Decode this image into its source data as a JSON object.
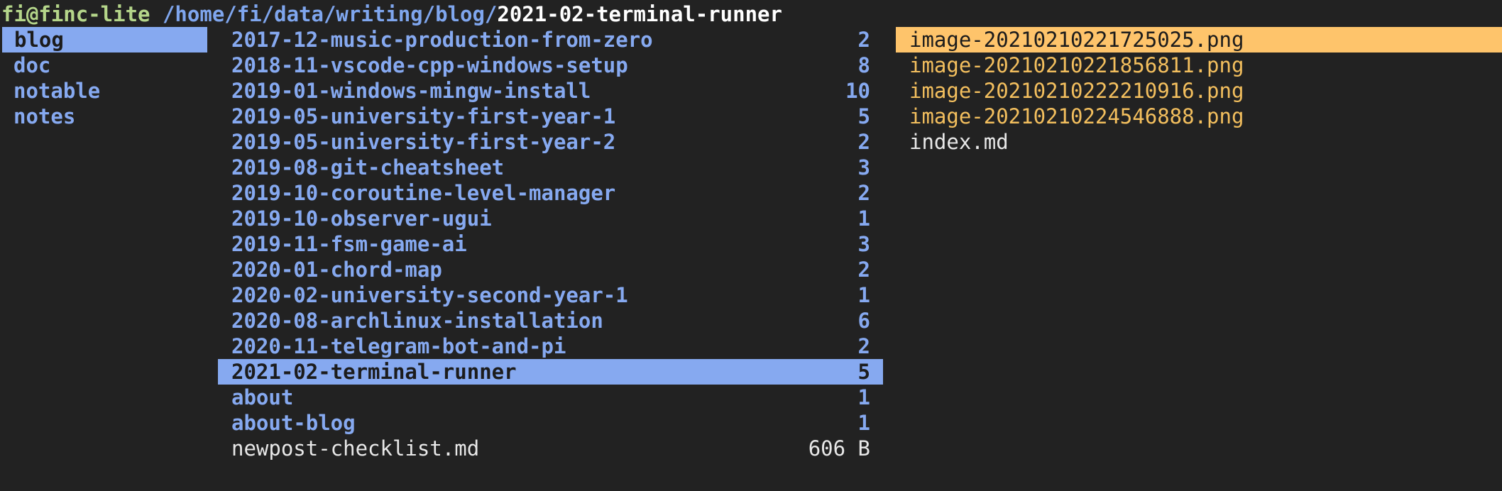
{
  "title": {
    "user_host": "fi@finc-lite",
    "path": " /home/fi/data/writing/blog/",
    "current": "2021-02-terminal-runner"
  },
  "parent_pane": {
    "items": [
      {
        "name": "blog",
        "selected": true
      },
      {
        "name": "doc"
      },
      {
        "name": "notable"
      },
      {
        "name": "notes"
      }
    ]
  },
  "current_pane": {
    "items": [
      {
        "name": "2017-12-music-production-from-zero",
        "count": "2"
      },
      {
        "name": "2018-11-vscode-cpp-windows-setup",
        "count": "8"
      },
      {
        "name": "2019-01-windows-mingw-install",
        "count": "10"
      },
      {
        "name": "2019-05-university-first-year-1",
        "count": "5"
      },
      {
        "name": "2019-05-university-first-year-2",
        "count": "2"
      },
      {
        "name": "2019-08-git-cheatsheet",
        "count": "3"
      },
      {
        "name": "2019-10-coroutine-level-manager",
        "count": "2"
      },
      {
        "name": "2019-10-observer-ugui",
        "count": "1"
      },
      {
        "name": "2019-11-fsm-game-ai",
        "count": "3"
      },
      {
        "name": "2020-01-chord-map",
        "count": "2"
      },
      {
        "name": "2020-02-university-second-year-1",
        "count": "1"
      },
      {
        "name": "2020-08-archlinux-installation",
        "count": "6"
      },
      {
        "name": "2020-11-telegram-bot-and-pi",
        "count": "2"
      },
      {
        "name": "2021-02-terminal-runner",
        "count": "5",
        "selected": true
      },
      {
        "name": "about",
        "count": "1"
      },
      {
        "name": "about-blog",
        "count": "1"
      },
      {
        "name": "newpost-checklist.md",
        "count": "606 B",
        "file": true
      }
    ]
  },
  "preview_pane": {
    "items": [
      {
        "name": "image-20210210221725025.png",
        "selected": true
      },
      {
        "name": "image-20210210221856811.png"
      },
      {
        "name": "image-20210210222210916.png"
      },
      {
        "name": "image-20210210224546888.png"
      },
      {
        "name": "index.md",
        "text": true
      }
    ]
  },
  "colors": {
    "background": "#222222",
    "directory": "#86a9f0",
    "image_file": "#f3bf5e",
    "selection": "#86a9f0",
    "preview_selection": "#fec46b",
    "user_host": "#b5d68a"
  }
}
